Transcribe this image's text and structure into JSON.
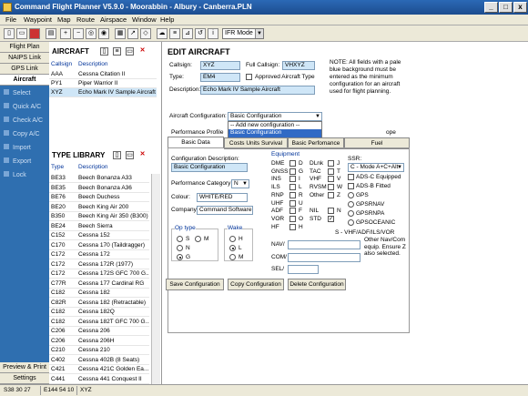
{
  "window": {
    "title": "Command Flight Planner V5.9.0  -  Moorabbin  -  Albury  -  Canberra.PLN",
    "min": "_",
    "max": "□",
    "close": "x"
  },
  "menu": [
    "File",
    "Waypoint",
    "Map",
    "Route",
    "Airspace",
    "Window",
    "Help"
  ],
  "toolbar": {
    "mode": "IFR Mode"
  },
  "nav": {
    "tabs": [
      "Flight Plan",
      "NAIPS Link",
      "GPS Link",
      "Aircraft"
    ],
    "actions": [
      "Select",
      "Quick A/C",
      "Check A/C",
      "Copy A/C",
      "Import",
      "Export",
      "Lock"
    ],
    "bottom": [
      "Preview & Print",
      "Settings"
    ]
  },
  "aircraft": {
    "title": "AIRCRAFT",
    "col1": "Callsign",
    "col2": "Description",
    "rows": [
      [
        "AAA",
        "Cessna Citation II"
      ],
      [
        "PY1",
        "Piper Warrior II"
      ],
      [
        "XYZ",
        "Echo Mark IV Sample Aircraft"
      ]
    ]
  },
  "types": {
    "title": "TYPE LIBRARY",
    "col1": "Type",
    "col2": "Description",
    "rows": [
      [
        "BE33",
        "Beech Bonanza A33"
      ],
      [
        "BE35",
        "Beech Bonanza A36"
      ],
      [
        "BE76",
        "Beech Duchess"
      ],
      [
        "BE20",
        "Beech King Air 200"
      ],
      [
        "B350",
        "Beech King Air 350 (B300)"
      ],
      [
        "BE24",
        "Beech Sierra"
      ],
      [
        "C152",
        "Cessna 152"
      ],
      [
        "C170",
        "Cessna 170 (Taildragger)"
      ],
      [
        "C172",
        "Cessna 172"
      ],
      [
        "C172",
        "Cessna 172R (1977)"
      ],
      [
        "C172",
        "Cessna 172S GFC 700 G..."
      ],
      [
        "C77R",
        "Cessna 177 Cardinal RG"
      ],
      [
        "C182",
        "Cessna 182"
      ],
      [
        "C82R",
        "Cessna 182 (Retractable)"
      ],
      [
        "C182",
        "Cessna 182Q"
      ],
      [
        "C182",
        "Cessna 182T GFC 700 G..."
      ],
      [
        "C206",
        "Cessna 206"
      ],
      [
        "C206",
        "Cessna 206H"
      ],
      [
        "C210",
        "Cessna 210"
      ],
      [
        "C402",
        "Cessna 402B (8 Seats)"
      ],
      [
        "C421",
        "Cessna 421C Golden Ea..."
      ],
      [
        "C441",
        "Cessna 441 Conquest II"
      ]
    ]
  },
  "edit": {
    "title": "EDIT AIRCRAFT",
    "callsign_l": "Callsign:",
    "callsign": "XYZ",
    "full_l": "Full Callsign:",
    "full": "VHXYZ",
    "type_l": "Type:",
    "type": "EM4",
    "approved": "Approved Aircraft Type",
    "desc_l": "Description:",
    "desc": "Echo Mark IV Sample Aircraft",
    "note": "NOTE: All fields with a pale blue background must be entered as the minimum configuration for an aircraft used for flight planning.",
    "config_l": "Aircraft Configuration:",
    "config": "Basic Configuration",
    "config_opt1": "-- Add new configuration --",
    "config_opt2": "Basic Configuration",
    "perf_profile": "Performance Profile",
    "tab_basic": "Basic Data",
    "tab_units": "Costs Units Survival",
    "tab_perf": "Basic Perfomance",
    "tab_fuel": "Fuel",
    "ope": "ope",
    "cfgdesc_l": "Configuration Description:",
    "cfgdesc": "Basic Configuration",
    "perfcat_l": "Performance Category:",
    "perfcat": "N",
    "colour_l": "Colour:",
    "colour": "WHITE/RED",
    "company_l": "Company:",
    "company": "Command Software",
    "optype": "Op type",
    "wake": "Wake",
    "op": [
      "S",
      "M",
      "N",
      "G"
    ],
    "wk": [
      "H",
      "L",
      "M"
    ],
    "equip_title": "Equipment",
    "equip": [
      [
        "DME",
        "D"
      ],
      [
        "GNSS",
        "G"
      ],
      [
        "INS",
        "I"
      ],
      [
        "ILS",
        "L"
      ],
      [
        "RNP",
        "R"
      ],
      [
        "UHF",
        "U"
      ],
      [
        "ADF",
        "F"
      ],
      [
        "VOR",
        "O"
      ],
      [
        "HF",
        "H"
      ]
    ],
    "equip2": [
      [
        "DLnk",
        "J"
      ],
      [
        "TAC",
        "T"
      ],
      [
        "VHF",
        "V"
      ],
      [
        "RVSM",
        "W"
      ],
      [
        "Other",
        "Z"
      ],
      [
        "NIL",
        "N"
      ],
      [
        "STD",
        "S"
      ]
    ],
    "ssr_l": "SSR:",
    "ssr": "C - Mode A+C+Alt",
    "ssr_opts": [
      "ADS-C Equipped",
      "ADS-B Fitted",
      "GPS",
      "GPSRNAV",
      "GPSRNPA",
      "GPSOCEANIC"
    ],
    "std_note": "S - VHF/ADF/ILS/VOR",
    "nav_l": "NAV/",
    "com_l": "COM/",
    "sel_l": "SEL/",
    "other_note": "Other Nav/Com equip. Ensure Z also selected.",
    "save": "Save Configuration",
    "copy": "Copy Configuration",
    "delete": "Delete Configuration"
  },
  "status": [
    "S38 30 27",
    "E144 54 10",
    "XYZ"
  ]
}
